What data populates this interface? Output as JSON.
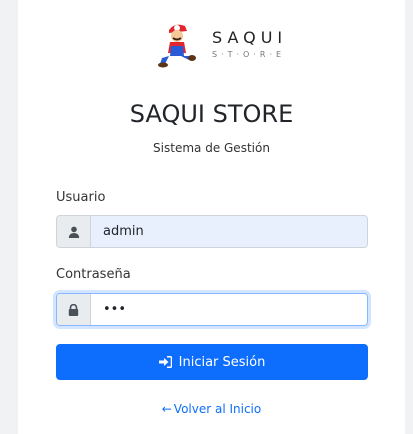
{
  "logo": {
    "brand_main": "SAQUI",
    "brand_sub": "S·T·O·R·E"
  },
  "header": {
    "title": "SAQUI STORE",
    "subtitle": "Sistema de Gestión"
  },
  "form": {
    "username_label": "Usuario",
    "username_value": "admin",
    "password_label": "Contraseña",
    "password_value": "•••",
    "submit_label": "Iniciar Sesión"
  },
  "footer": {
    "back_link": "Volver al Inicio"
  },
  "colors": {
    "primary": "#0d6efd",
    "autofill_bg": "#e8f0fe",
    "addon_bg": "#e9ecef"
  },
  "icons": {
    "user": "user-icon",
    "lock": "lock-icon",
    "login": "sign-in-icon",
    "back": "arrow-left-icon"
  }
}
